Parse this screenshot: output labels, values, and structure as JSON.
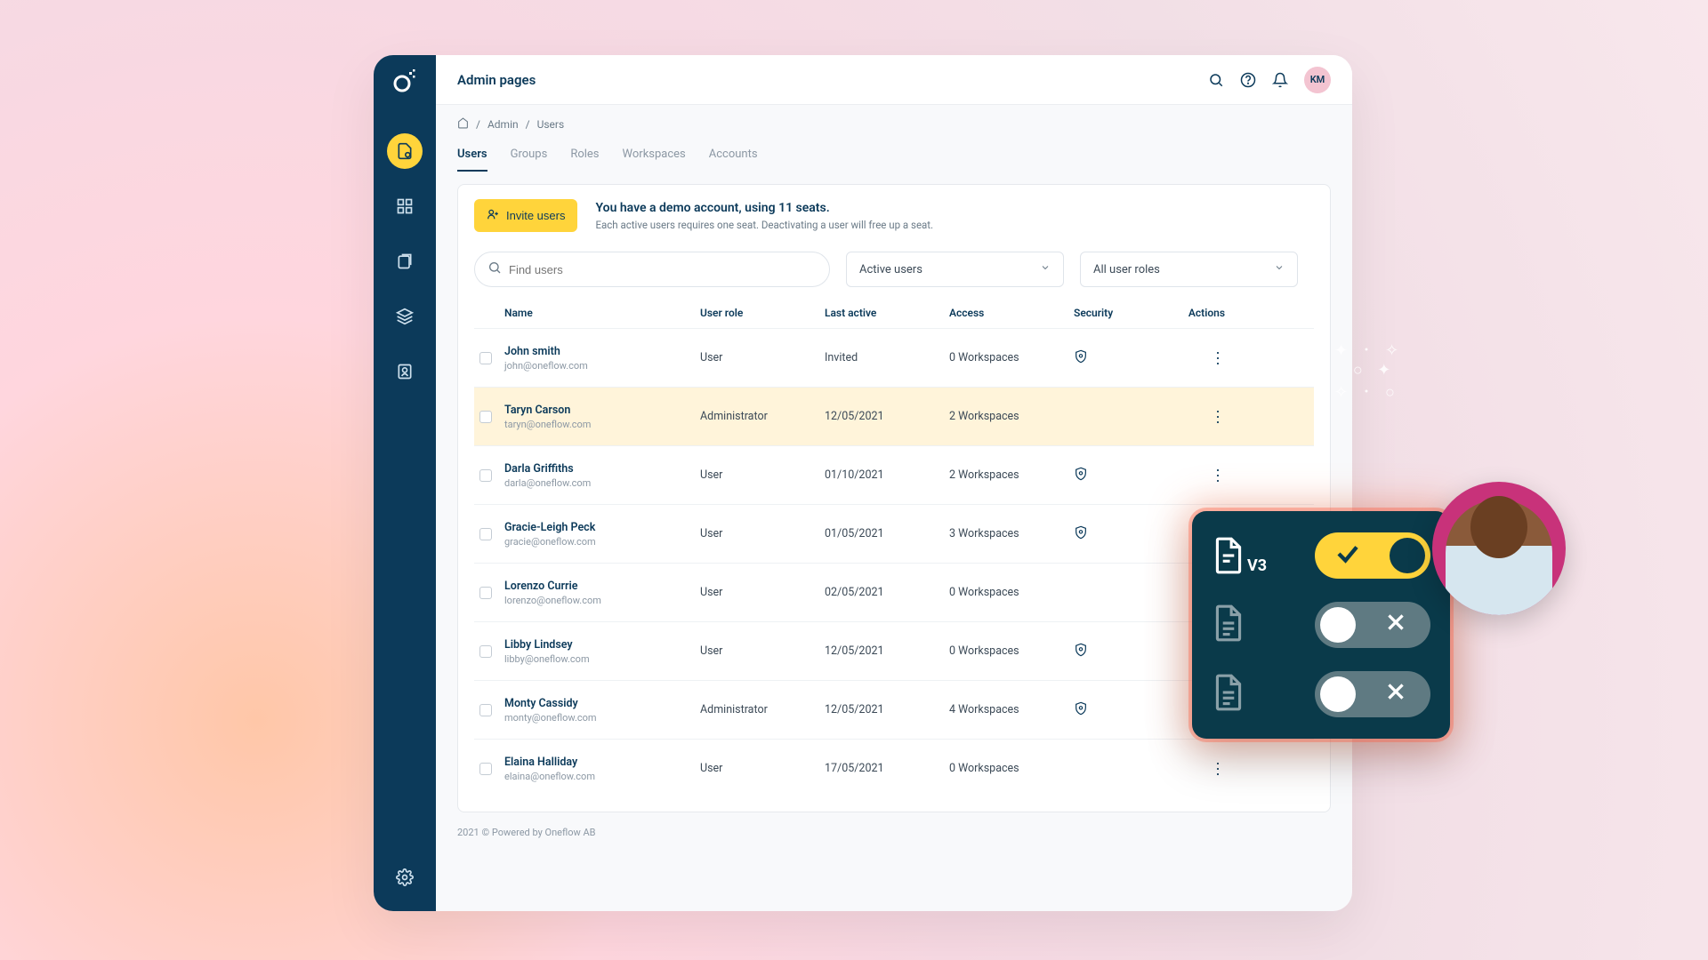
{
  "header": {
    "title": "Admin pages",
    "avatar_initials": "KM"
  },
  "breadcrumb": {
    "home": "⌂",
    "sep": "/",
    "item1": "Admin",
    "item2": "Users"
  },
  "tabs": [
    "Users",
    "Groups",
    "Roles",
    "Workspaces",
    "Accounts"
  ],
  "banner": {
    "invite_label": "Invite users",
    "title": "You have a demo account, using 11 seats.",
    "subtitle": "Each active users requires one seat. Deactivating a user will free up a seat."
  },
  "filters": {
    "search_placeholder": "Find users",
    "status_label": "Active users",
    "roles_label": "All user roles"
  },
  "columns": {
    "name": "Name",
    "role": "User role",
    "last_active": "Last active",
    "access": "Access",
    "security": "Security",
    "actions": "Actions"
  },
  "users": [
    {
      "name": "John smith",
      "email": "john@oneflow.com",
      "role": "User",
      "last_active": "Invited",
      "access": "0 Workspaces",
      "security": true,
      "highlight": false
    },
    {
      "name": "Taryn Carson",
      "email": "taryn@oneflow.com",
      "role": "Administrator",
      "last_active": "12/05/2021",
      "access": "2 Workspaces",
      "security": false,
      "highlight": true
    },
    {
      "name": "Darla Griffiths",
      "email": "darla@oneflow.com",
      "role": "User",
      "last_active": "01/10/2021",
      "access": "2 Workspaces",
      "security": true,
      "highlight": false
    },
    {
      "name": "Gracie-Leigh Peck",
      "email": "gracie@oneflow.com",
      "role": "User",
      "last_active": "01/05/2021",
      "access": "3 Workspaces",
      "security": true,
      "highlight": false
    },
    {
      "name": "Lorenzo Currie",
      "email": "lorenzo@oneflow.com",
      "role": "User",
      "last_active": "02/05/2021",
      "access": "0 Workspaces",
      "security": false,
      "highlight": false
    },
    {
      "name": "Libby Lindsey",
      "email": "libby@oneflow.com",
      "role": "User",
      "last_active": "12/05/2021",
      "access": "0 Workspaces",
      "security": true,
      "highlight": false
    },
    {
      "name": "Monty Cassidy",
      "email": "monty@oneflow.com",
      "role": "Administrator",
      "last_active": "12/05/2021",
      "access": "4 Workspaces",
      "security": true,
      "highlight": false
    },
    {
      "name": "Elaina Halliday",
      "email": "elaina@oneflow.com",
      "role": "User",
      "last_active": "17/05/2021",
      "access": "0 Workspaces",
      "security": false,
      "highlight": false
    }
  ],
  "footer": "2021 © Powered by Oneflow AB",
  "overlay": {
    "row1_label": "V3",
    "toggles": [
      {
        "on": true
      },
      {
        "on": false
      },
      {
        "on": false
      }
    ]
  }
}
